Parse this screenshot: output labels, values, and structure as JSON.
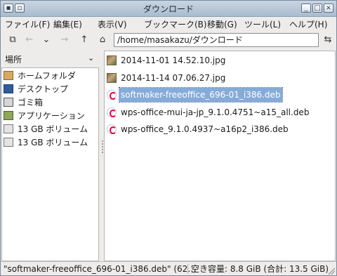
{
  "window": {
    "title": "ダウンロード"
  },
  "menubar": {
    "file": "ファイル(F)",
    "edit": "編集(E)",
    "view": "表示(V)",
    "bookmarks": "ブックマーク(B)",
    "go": "移動(G)",
    "tools": "ツール(L)",
    "help": "ヘルプ(H)"
  },
  "toolbar": {
    "path": "/home/masakazu/ダウンロード"
  },
  "sidebar": {
    "header": "場所",
    "items": [
      {
        "label": "ホームフォルダ",
        "icon": "home-folder-icon"
      },
      {
        "label": "デスクトップ",
        "icon": "desktop-icon"
      },
      {
        "label": "ゴミ箱",
        "icon": "trash-icon"
      },
      {
        "label": "アプリケーション",
        "icon": "applications-icon"
      },
      {
        "label": "13 GB ボリューム",
        "icon": "drive-icon"
      },
      {
        "label": "13 GB ボリューム",
        "icon": "drive-icon"
      }
    ]
  },
  "files": [
    {
      "name": "2014-11-01 14.52.10.jpg",
      "icon": "image-file-icon",
      "selected": false
    },
    {
      "name": "2014-11-14 07.06.27.jpg",
      "icon": "image-file-icon",
      "selected": false
    },
    {
      "name": "softmaker-freeoffice_696-01_i386.deb",
      "icon": "deb-package-icon",
      "selected": true
    },
    {
      "name": "wps-office-mui-ja-jp_9.1.0.4751~a15_all.deb",
      "icon": "deb-package-icon",
      "selected": false
    },
    {
      "name": "wps-office_9.1.0.4937~a16p2_i386.deb",
      "icon": "deb-package-icon",
      "selected": false
    }
  ],
  "status": {
    "selection": "\"softmaker-freeoffice_696-01_i386.deb\" (62…",
    "space": "空き容量: 8.8 GiB (合計: 13.5 GiB)"
  }
}
